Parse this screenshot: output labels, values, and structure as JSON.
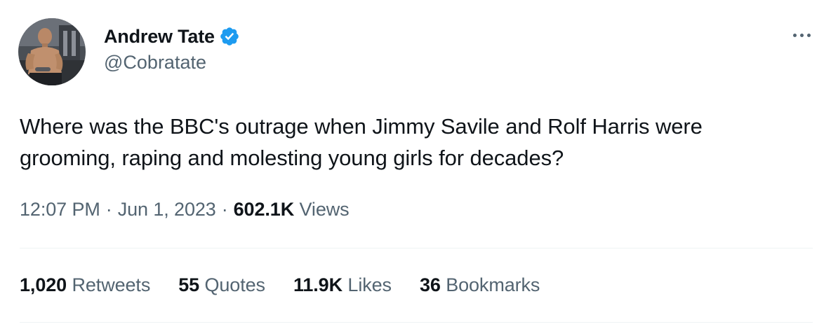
{
  "author": {
    "display_name": "Andrew Tate",
    "handle": "@Cobratate",
    "verified": true,
    "verified_color": "#1d9bf0"
  },
  "tweet": {
    "text_line1": "Where was the BBC's outrage when Jimmy Savile and Rolf Harris were",
    "text_line2": "grooming, raping and molesting young girls for decades?",
    "time": "12:07 PM",
    "date": "Jun 1, 2023",
    "separator": "·",
    "views_count": "602.1K",
    "views_label": "Views"
  },
  "stats": [
    {
      "count": "1,020",
      "label": "Retweets"
    },
    {
      "count": "55",
      "label": "Quotes"
    },
    {
      "count": "11.9K",
      "label": "Likes"
    },
    {
      "count": "36",
      "label": "Bookmarks"
    }
  ],
  "icons": {
    "more": "more-horizontal-icon",
    "verified": "verified-badge-icon"
  },
  "colors": {
    "text_primary": "#0f1419",
    "text_secondary": "#536471",
    "divider": "#eff3f4",
    "accent": "#1d9bf0"
  }
}
